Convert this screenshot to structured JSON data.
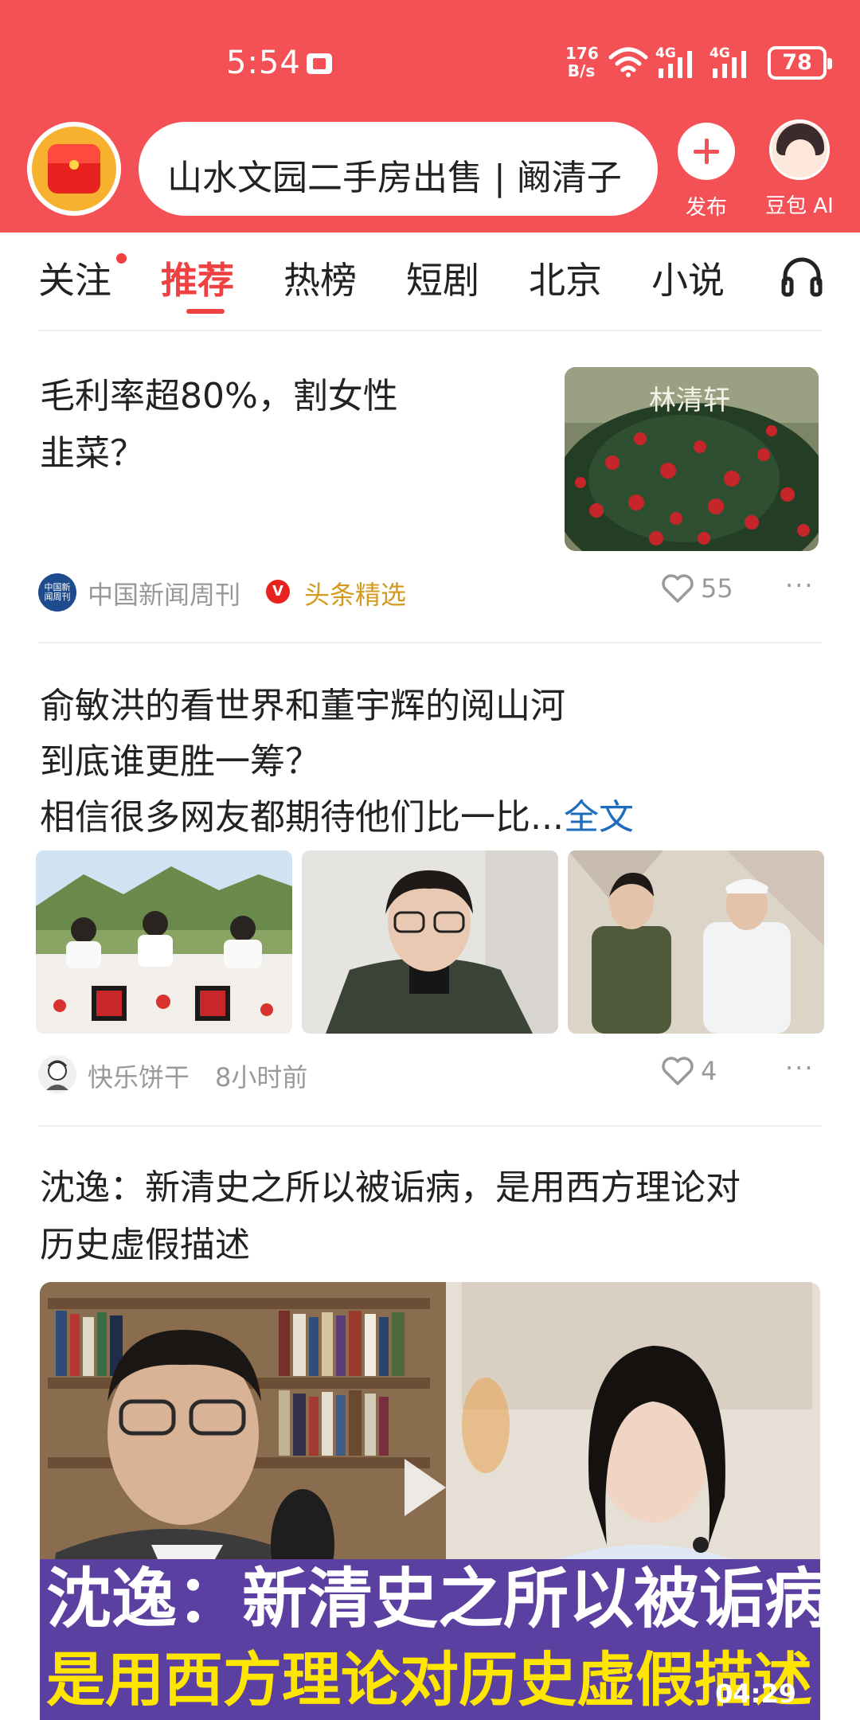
{
  "status_bar": {
    "time": "5:54",
    "net_speed": "176",
    "net_unit": "B/s",
    "signal_1": "4G",
    "signal_2": "4G",
    "battery": "78"
  },
  "header": {
    "search_text": "山水文园二手房出售 | 阚清子",
    "publish_label": "发布",
    "ai_label": "豆包 AI",
    "accent_color": "#f35155"
  },
  "tabs": {
    "items": [
      "关注",
      "推荐",
      "热榜",
      "短剧",
      "北京",
      "小说"
    ],
    "active": "推荐",
    "listen_icon": "headphones-icon"
  },
  "feed": {
    "article1": {
      "title_line1": "毛利率超80%，割女性",
      "title_line2": "韭菜？",
      "thumb_text": "林清轩",
      "source": "中国新闻周刊",
      "source_icon_text": "中国新闻周刊",
      "verified": "V",
      "tag": "头条精选",
      "likes": "55",
      "more": "···"
    },
    "article2": {
      "title_line1": "俞敏洪的看世界和董宇辉的阅山河",
      "title_line2": "到底谁更胜一筹？",
      "title_line3": "相信很多网友都期待他们比一比...",
      "full_text_link": "全文",
      "source": "快乐饼干",
      "time": "8小时前",
      "likes": "4",
      "more": "···"
    },
    "article3": {
      "title_line1": "沈逸：新清史之所以被诟病，是用西方理论对",
      "title_line2": "历史虚假描述",
      "caption_line1": "沈逸：新清史之所以被诟病",
      "caption_line2": "是用西方理论对历史虚假描述",
      "duration": "04:29"
    }
  }
}
